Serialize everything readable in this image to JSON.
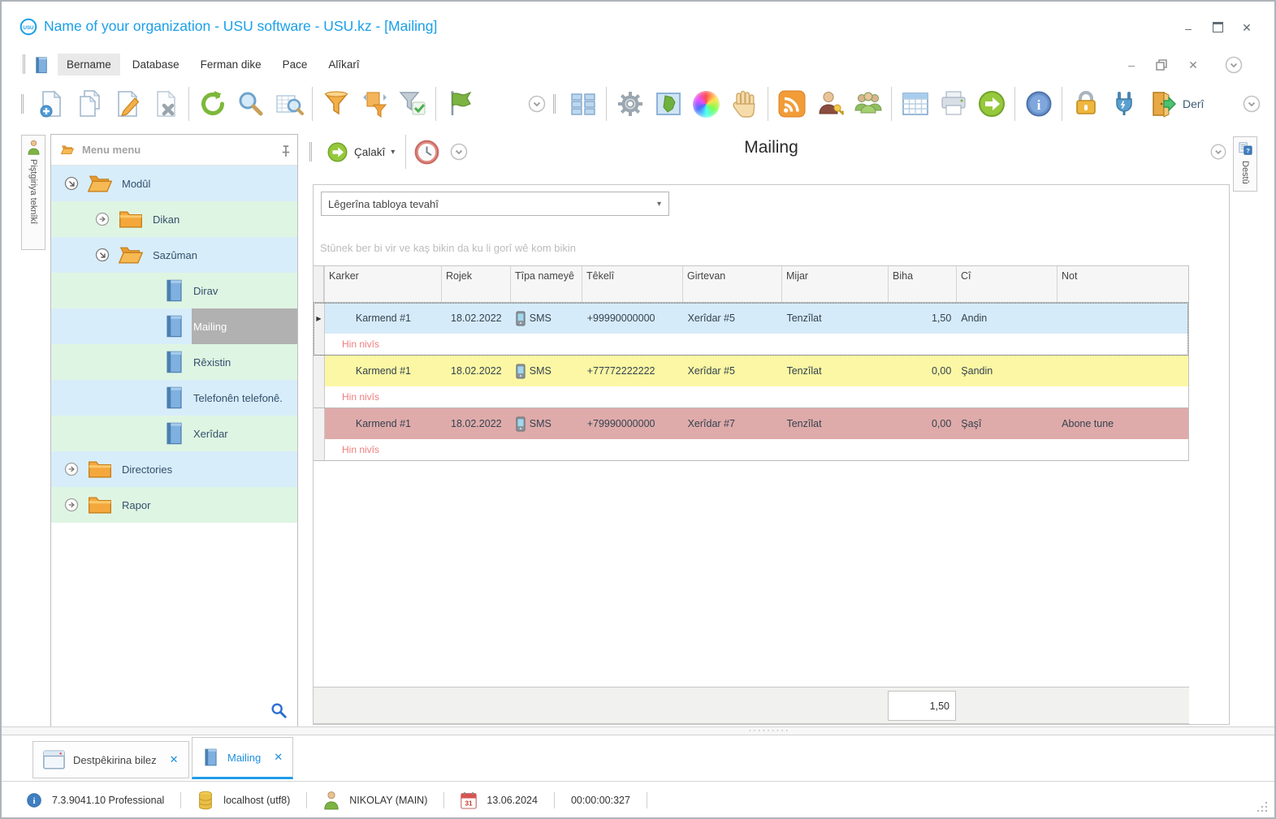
{
  "window": {
    "title": "Name of your organization - USU software - USU.kz - [Mailing]"
  },
  "menu": {
    "items": [
      {
        "label": "Bername",
        "highlighted": true
      },
      {
        "label": "Database"
      },
      {
        "label": "Ferman dike"
      },
      {
        "label": "Pace"
      },
      {
        "label": "Alîkarî"
      }
    ]
  },
  "toolbar": {
    "exit_label": "Derî"
  },
  "side_tabs": {
    "left": "Piştgiriya teknîkî",
    "right": "Destû"
  },
  "sidebar": {
    "header": "Menu menu",
    "tree": [
      {
        "label": "Modûl",
        "level": 1,
        "icon": "folder-open",
        "expand": "open"
      },
      {
        "label": "Dikan",
        "level": 2,
        "icon": "folder",
        "expand": "closed"
      },
      {
        "label": "Sazûman",
        "level": 2,
        "icon": "folder-open",
        "expand": "open"
      },
      {
        "label": "Dirav",
        "level": 3,
        "icon": "book"
      },
      {
        "label": "Mailing",
        "level": 3,
        "icon": "book",
        "selected": true
      },
      {
        "label": "Rêxistin",
        "level": 3,
        "icon": "book"
      },
      {
        "label": "Telefonên telefonê.",
        "level": 3,
        "icon": "book"
      },
      {
        "label": "Xerîdar",
        "level": 3,
        "icon": "book"
      },
      {
        "label": "Directories",
        "level": 1,
        "icon": "folder",
        "expand": "closed"
      },
      {
        "label": "Rapor",
        "level": 1,
        "icon": "folder",
        "expand": "closed"
      }
    ]
  },
  "main": {
    "action_label": "Çalakî",
    "title": "Mailing",
    "search_text": "Lêgerîna tabloya tevahî",
    "group_hint": "Stûnek ber bi vir ve kaş bikin da ku li gorî wê kom bikin",
    "table": {
      "columns": [
        "Karker",
        "Rojek",
        "Tîpa nameyê",
        "Têkelî",
        "Girtevan",
        "Mijar",
        "Biha",
        "Cî",
        "Not"
      ],
      "rows": [
        {
          "karker": "Karmend #1",
          "date": "18.02.2022",
          "type": "SMS",
          "contact": "+99990000000",
          "recipient": "Xerîdar #5",
          "subject": "Tenzîlat",
          "price": "1,50",
          "status": "Andin",
          "note": "",
          "text": "Hin nivîs",
          "color": "blue",
          "selected": true
        },
        {
          "karker": "Karmend #1",
          "date": "18.02.2022",
          "type": "SMS",
          "contact": "+77772222222",
          "recipient": "Xerîdar #5",
          "subject": "Tenzîlat",
          "price": "0,00",
          "status": "Şandin",
          "note": "",
          "text": "Hin nivîs",
          "color": "yellow"
        },
        {
          "karker": "Karmend #1",
          "date": "18.02.2022",
          "type": "SMS",
          "contact": "+79990000000",
          "recipient": "Xerîdar #7",
          "subject": "Tenzîlat",
          "price": "0,00",
          "status": "Şaşî",
          "note": "Abone tune",
          "text": "Hin nivîs",
          "color": "pink"
        }
      ],
      "footer_sum": "1,50"
    }
  },
  "tabs": [
    {
      "label": "Destpêkirina bilez",
      "icon": "window",
      "active": false
    },
    {
      "label": "Mailing",
      "icon": "book",
      "active": true
    }
  ],
  "statusbar": {
    "version": "7.3.9041.10 Professional",
    "database": "localhost (utf8)",
    "user": "NIKOLAY (MAIN)",
    "date": "13.06.2024",
    "timer": "00:00:00:327"
  },
  "colors": {
    "accent_blue": "#1a9fe8",
    "row_blue": "#d6ebf9",
    "row_yellow": "#fbf7a4",
    "row_pink": "#dfabaa",
    "note_red": "#ef7d7d",
    "selection_gray": "#b1b1b1"
  },
  "icons": [
    "usu-logo",
    "menu-book-icon",
    "new-document-icon",
    "copy-document-icon",
    "edit-document-icon",
    "delete-document-icon",
    "refresh-icon",
    "search-icon",
    "search-table-icon",
    "filter-icon",
    "filter-columns-icon",
    "filter-check-icon",
    "flag-icon",
    "chevron-circle-icon",
    "grid-views-icon",
    "gear-icon",
    "map-icon",
    "color-wheel-icon",
    "hand-icon",
    "rss-icon",
    "user-key-icon",
    "users-group-icon",
    "table-icon",
    "printer-icon",
    "go-arrow-icon",
    "info-icon",
    "lock-icon",
    "plug-icon",
    "exit-door-icon",
    "clock-icon",
    "pin-icon",
    "folder-icon",
    "folder-open-icon",
    "book-icon",
    "phone-icon",
    "window-icon",
    "database-icon",
    "person-icon",
    "calendar-icon",
    "magnifier-icon"
  ]
}
